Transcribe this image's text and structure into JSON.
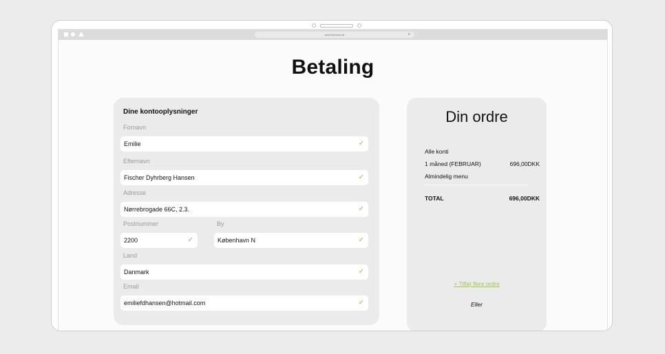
{
  "browser": {
    "url": "www.Divinehus.dk"
  },
  "page": {
    "title": "Betaling"
  },
  "account": {
    "section_title": "Dine kontooplysninger",
    "fields": {
      "first_name": {
        "label": "Fornavn",
        "value": "Emilie"
      },
      "last_name": {
        "label": "Efternavn",
        "value": "Fischer Dyhrberg Hansen"
      },
      "address": {
        "label": "Adresse",
        "value": "Nørrebrogade 66C, 2.3."
      },
      "postal_code": {
        "label": "Postnummer",
        "value": "2200"
      },
      "city": {
        "label": "By",
        "value": "København N"
      },
      "country": {
        "label": "Land",
        "value": "Danmark"
      },
      "email": {
        "label": "Email",
        "value": "emiliefdhansen@hotmail.com"
      }
    },
    "check_glyph": "✓"
  },
  "order": {
    "title": "Din ordre",
    "plan": "Alle konti",
    "period": "1 måned (FEBRUAR)",
    "price": "696,00DKK",
    "menu": "Almindelig menu",
    "total_label": "TOTAL",
    "total_value": "696,00DKK",
    "add_link": "+ Tilføj flere ordre",
    "or_text": "Eller"
  },
  "colors": {
    "accent": "#8fc33c",
    "card_bg": "#ebebeb",
    "label": "#9a9a9a"
  }
}
